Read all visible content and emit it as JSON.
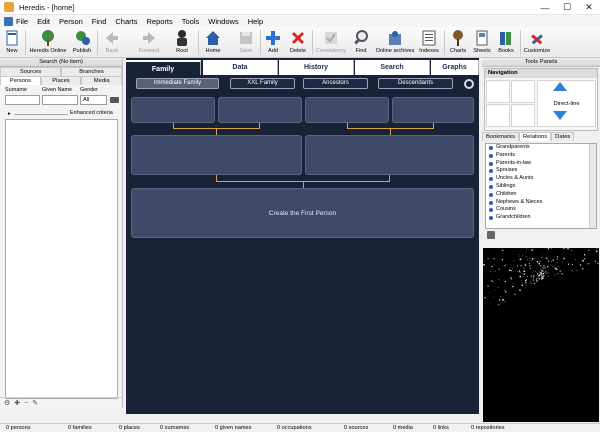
{
  "window": {
    "title": "Heredis - [home]",
    "controls": [
      "—",
      "☐",
      "✕"
    ]
  },
  "menu": [
    "File",
    "Edit",
    "Person",
    "Find",
    "Charts",
    "Reports",
    "Tools",
    "Windows",
    "Help"
  ],
  "toolbar": [
    {
      "key": "new",
      "label": "New",
      "icon": "new-file-icon"
    },
    {
      "key": "online",
      "label": "Heredis Online",
      "icon": "tree-online-icon"
    },
    {
      "key": "publish",
      "label": "Publish",
      "icon": "publish-icon"
    },
    {
      "key": "back",
      "label": "Back",
      "icon": "back-arrow-icon",
      "disabled": true
    },
    {
      "key": "forward",
      "label": "Forward",
      "icon": "forward-arrow-icon",
      "disabled": true
    },
    {
      "key": "root",
      "label": "Root",
      "icon": "root-person-icon"
    },
    {
      "key": "home",
      "label": "Home",
      "icon": "home-icon"
    },
    {
      "key": "save",
      "label": "Save",
      "icon": "save-icon",
      "disabled": true
    },
    {
      "key": "add",
      "label": "Add",
      "icon": "add-icon"
    },
    {
      "key": "delete",
      "label": "Delete",
      "icon": "delete-icon"
    },
    {
      "key": "consistency",
      "label": "Consistency",
      "icon": "consistency-icon",
      "disabled": true
    },
    {
      "key": "find",
      "label": "Find",
      "icon": "find-icon"
    },
    {
      "key": "archives",
      "label": "Online archives",
      "icon": "archives-icon"
    },
    {
      "key": "indexes",
      "label": "Indexes",
      "icon": "indexes-icon"
    },
    {
      "key": "charts",
      "label": "Charts",
      "icon": "charts-icon"
    },
    {
      "key": "sheets",
      "label": "Sheets",
      "icon": "sheets-icon"
    },
    {
      "key": "books",
      "label": "Books",
      "icon": "books-icon"
    },
    {
      "key": "customize",
      "label": "Customize",
      "icon": "customize-icon"
    }
  ],
  "left": {
    "header": "Search (No item)",
    "tabs_top": [
      "Sources",
      "Branches"
    ],
    "tabs_bottom": [
      "Persons",
      "Places",
      "Media"
    ],
    "fields": {
      "surname": "Surname",
      "given": "Given Name",
      "gender": "Gender",
      "gender_value": "All"
    },
    "enhanced": "Enhanced criteria"
  },
  "center": {
    "tabs": [
      "Family",
      "Data",
      "History",
      "Search",
      "Graphs"
    ],
    "subtabs": [
      "Immediate Family",
      "XXL Family",
      "Ancestors",
      "Descendants"
    ],
    "create_label": "Create the First Person"
  },
  "right": {
    "header": "Tools Panels",
    "nav_title": "Navigation",
    "direct_line": "Direct-line",
    "tabs": [
      "Bookmarks",
      "Relations",
      "Dates"
    ],
    "relations": [
      "Grandparents",
      "Parents",
      "Parents-in-law",
      "Spouses",
      "Uncles & Aunts",
      "Siblings",
      "Children",
      "Nephews & Nieces",
      "Cousins",
      "Grandchildren"
    ]
  },
  "status": [
    "0 persons",
    "0 families",
    "0 places",
    "0 surnames",
    "0 given names",
    "0 occupations",
    "0 sources",
    "0 media",
    "0 links",
    "0 repositories"
  ],
  "colors": {
    "accent": "#d6a43c",
    "panel": "#1a2238",
    "box": "#3e4a67"
  }
}
